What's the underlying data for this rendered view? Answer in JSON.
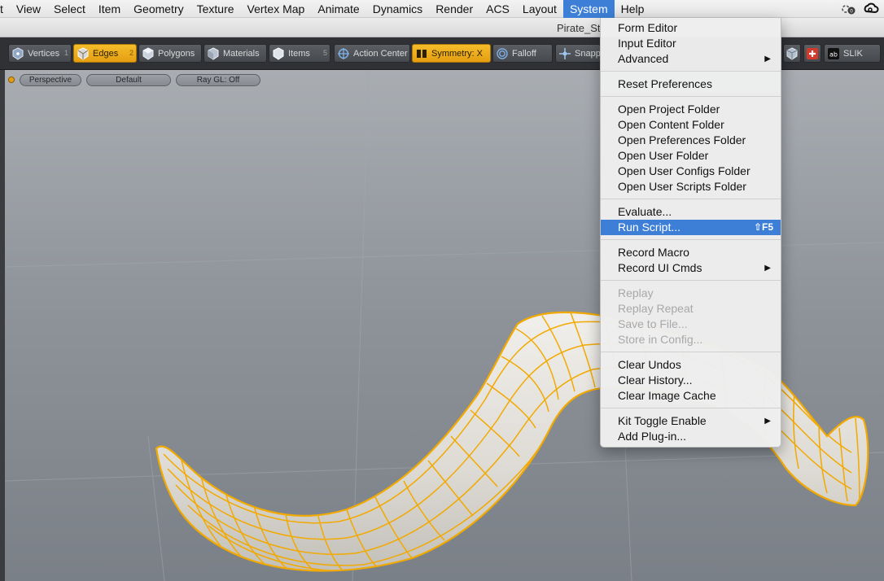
{
  "menubar": {
    "items": [
      {
        "label": "t"
      },
      {
        "label": "View"
      },
      {
        "label": "Select"
      },
      {
        "label": "Item"
      },
      {
        "label": "Geometry"
      },
      {
        "label": "Texture"
      },
      {
        "label": "Vertex Map"
      },
      {
        "label": "Animate"
      },
      {
        "label": "Dynamics"
      },
      {
        "label": "Render"
      },
      {
        "label": "ACS"
      },
      {
        "label": "Layout"
      },
      {
        "label": "System"
      },
      {
        "label": "Help"
      }
    ],
    "active": "System",
    "tray": [
      "sync-status-icon",
      "creative-cloud-icon"
    ]
  },
  "window": {
    "title": "Pirate_St"
  },
  "toolbar": {
    "buttons": [
      {
        "label": "Vertices",
        "hotkey": "1",
        "icon": "vertices-icon"
      },
      {
        "label": "Edges",
        "hotkey": "2",
        "icon": "edges-icon",
        "active": true
      },
      {
        "label": "Polygons",
        "hotkey": "",
        "icon": "polygons-icon"
      },
      {
        "label": "Materials",
        "hotkey": "",
        "icon": "materials-icon"
      },
      {
        "label": "Items",
        "hotkey": "5",
        "icon": "items-icon"
      },
      {
        "label": "Action Center",
        "hotkey": "",
        "icon": "action-center-icon"
      },
      {
        "label": "Symmetry: X",
        "hotkey": "",
        "icon": "symmetry-icon",
        "active": true
      },
      {
        "label": "Falloff",
        "hotkey": "",
        "icon": "falloff-icon"
      },
      {
        "label": "Snapp",
        "hotkey": "",
        "icon": "snapping-icon"
      }
    ],
    "right_buttons": [
      {
        "label": "",
        "icon": "cube-icon"
      },
      {
        "label": "",
        "icon": "add-kit-icon"
      },
      {
        "label": "SLIK",
        "icon": "slik-icon"
      }
    ]
  },
  "viewport": {
    "view": "Perspective",
    "style": "Default",
    "raygl": "Ray GL: Off"
  },
  "system_menu": {
    "sections": [
      [
        {
          "label": "Form Editor"
        },
        {
          "label": "Input Editor"
        },
        {
          "label": "Advanced",
          "submenu": true
        }
      ],
      [
        {
          "label": "Reset Preferences"
        }
      ],
      [
        {
          "label": "Open Project Folder"
        },
        {
          "label": "Open Content Folder"
        },
        {
          "label": "Open Preferences Folder"
        },
        {
          "label": "Open User Folder"
        },
        {
          "label": "Open User Configs Folder"
        },
        {
          "label": "Open User Scripts Folder"
        }
      ],
      [
        {
          "label": "Evaluate..."
        },
        {
          "label": "Run Script...",
          "shortcut": "⇧F5",
          "highlighted": true
        }
      ],
      [
        {
          "label": "Record Macro"
        },
        {
          "label": "Record UI Cmds",
          "submenu": true
        }
      ],
      [
        {
          "label": "Replay",
          "disabled": true
        },
        {
          "label": "Replay Repeat",
          "disabled": true
        },
        {
          "label": "Save to File...",
          "disabled": true
        },
        {
          "label": "Store in Config...",
          "disabled": true
        }
      ],
      [
        {
          "label": "Clear Undos"
        },
        {
          "label": "Clear History..."
        },
        {
          "label": "Clear Image Cache"
        }
      ],
      [
        {
          "label": "Kit Toggle Enable",
          "submenu": true
        },
        {
          "label": "Add Plug-in..."
        }
      ]
    ]
  },
  "colors": {
    "accent": "#3d7fd6",
    "active_tool": "#e59e12",
    "wireframe": "#f2a900",
    "mesh": "#e4e1dc"
  }
}
